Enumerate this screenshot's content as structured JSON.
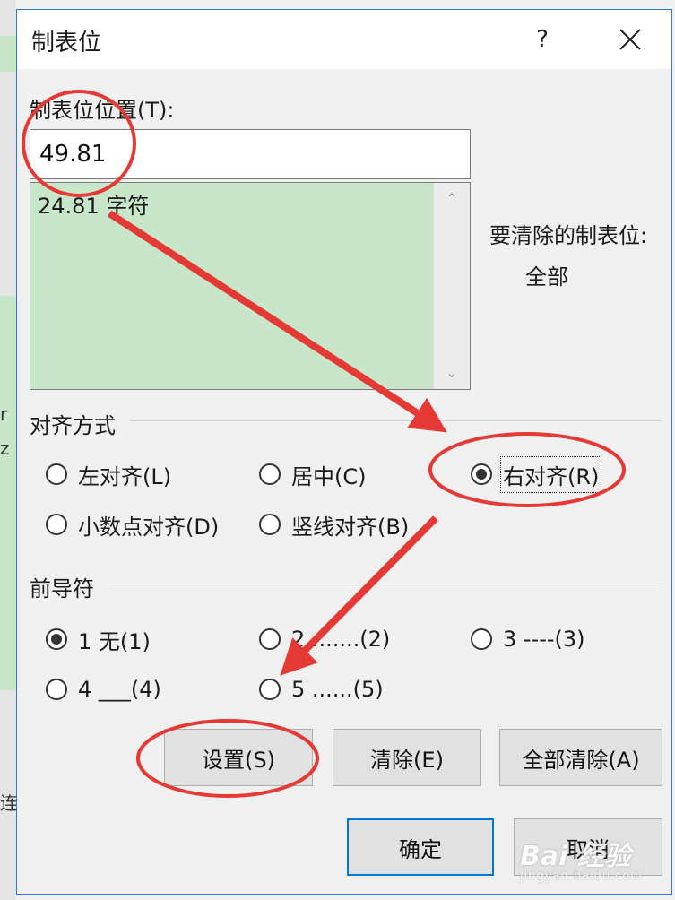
{
  "background": {
    "left_char_1": "r",
    "left_char_2": "z",
    "left_char_3": "连"
  },
  "dialog": {
    "title": "制表位",
    "help_label": "?",
    "close_icon": "close-icon"
  },
  "tab_position": {
    "label": "制表位位置(T):",
    "value": "49.81",
    "list_items": [
      "24.81 字符"
    ]
  },
  "clear": {
    "label": "要清除的制表位:",
    "value": "全部"
  },
  "alignment": {
    "label": "对齐方式",
    "options": [
      "左对齐(L)",
      "居中(C)",
      "右对齐(R)",
      "小数点对齐(D)",
      "竖线对齐(B)"
    ],
    "selected": "右对齐(R)"
  },
  "leader": {
    "label": "前导符",
    "options": [
      "1 无(1)",
      "2 .......(2)",
      "3 ----(3)",
      "4 ___(4)",
      "5 ......(5)"
    ],
    "selected": "1 无(1)"
  },
  "buttons": {
    "set": "设置(S)",
    "clear": "清除(E)",
    "clear_all": "全部清除(A)",
    "ok": "确定",
    "cancel": "取消"
  },
  "watermark": {
    "brand": "Bai 经验",
    "url": "jingyan.baidu.com"
  },
  "colors": {
    "annotation": "#e53935",
    "list_bg": "#c8e6c9",
    "focus_border": "#0078d7"
  }
}
